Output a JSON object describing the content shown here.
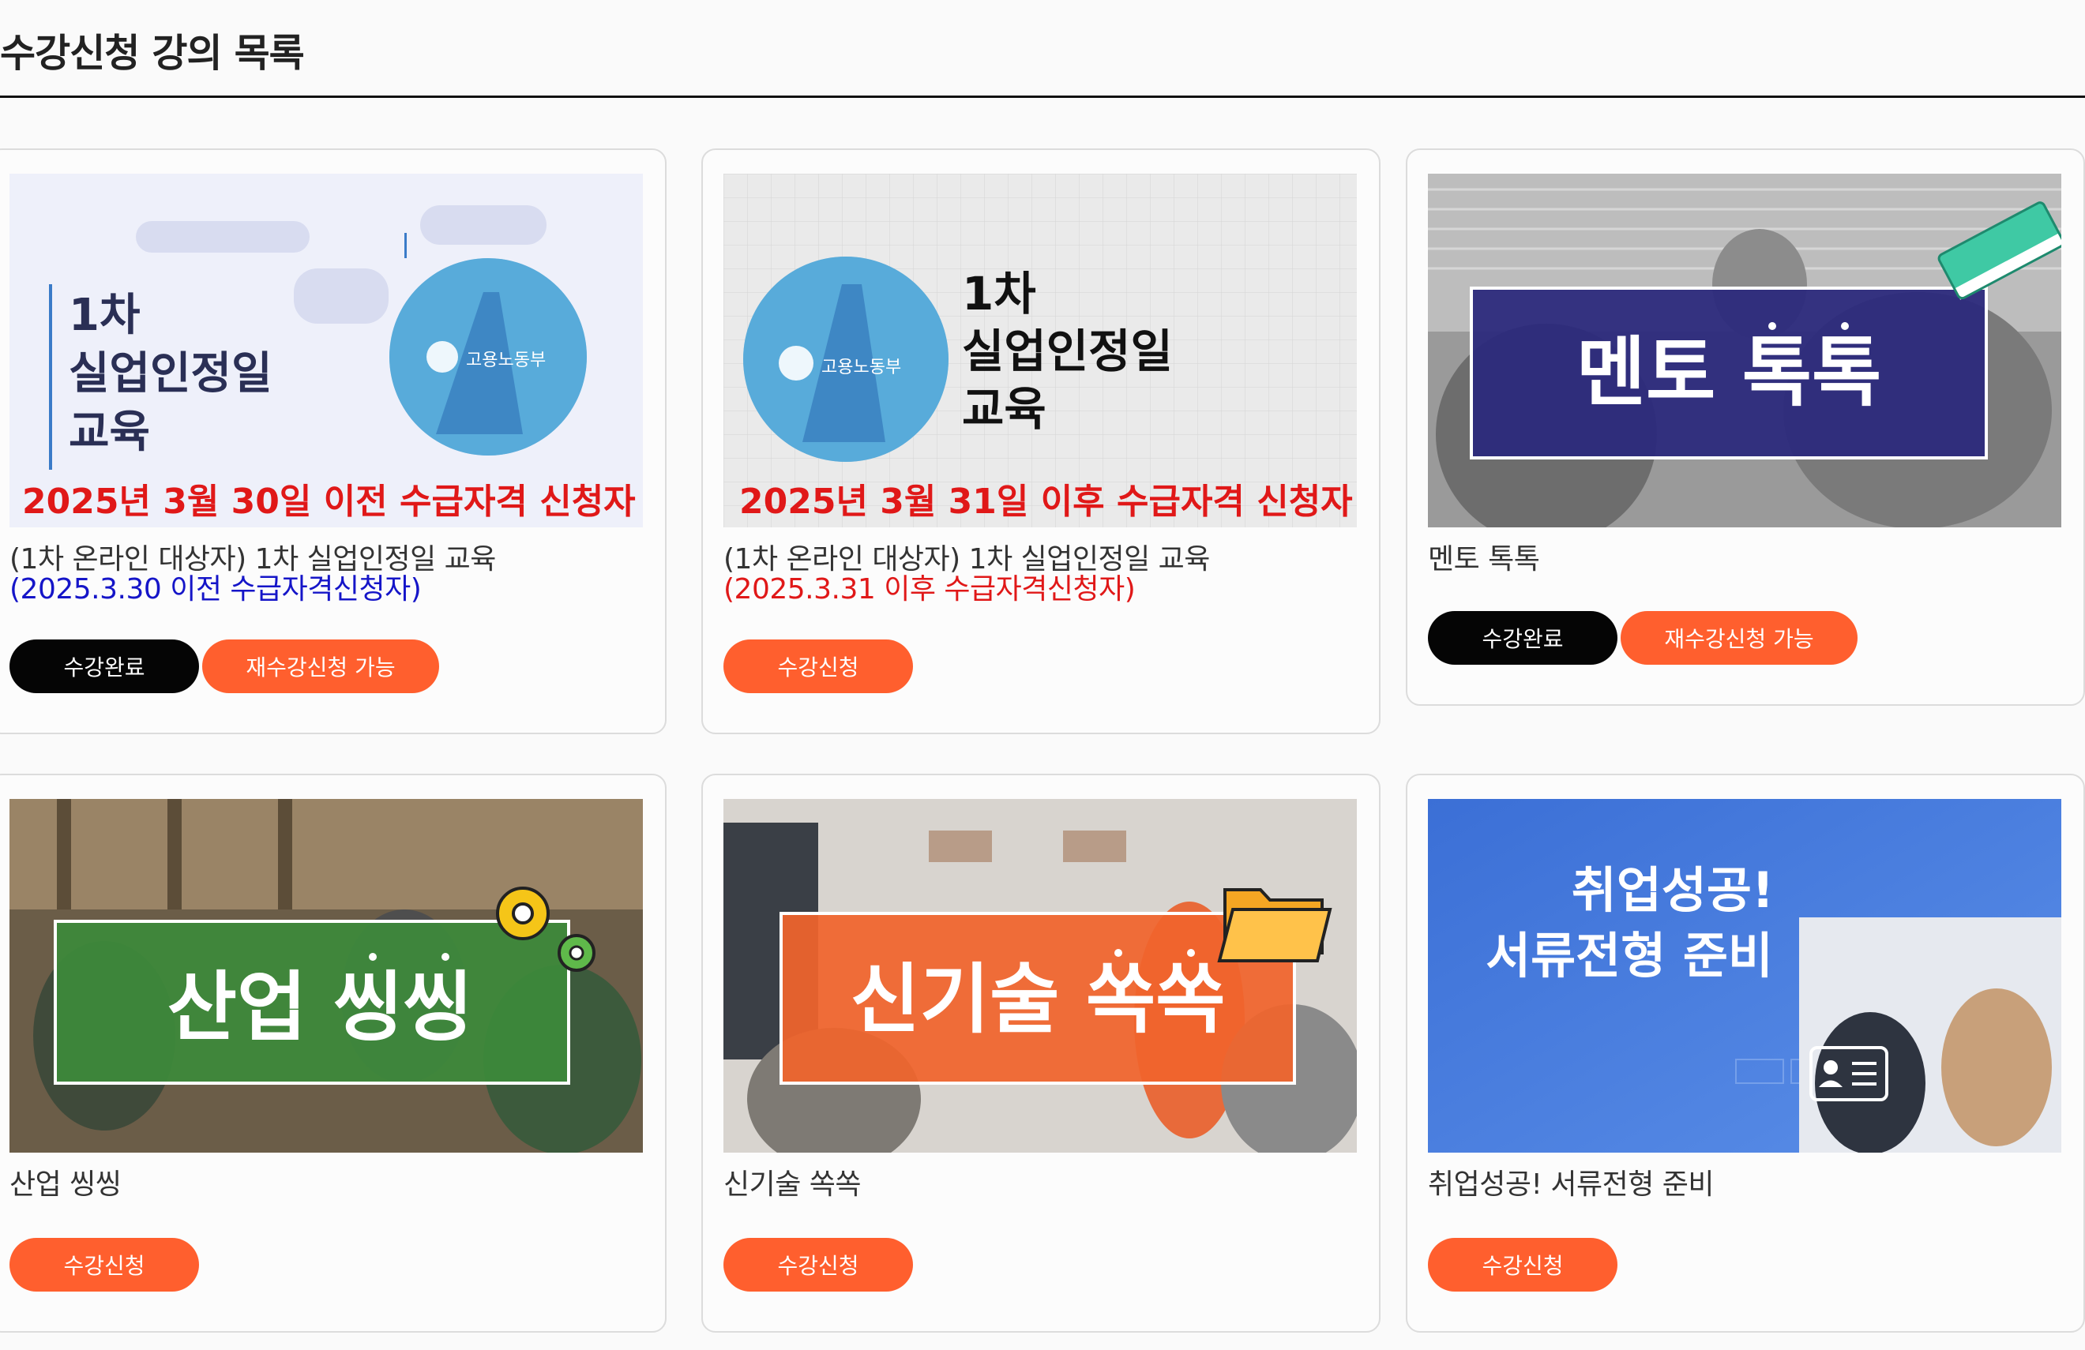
{
  "page": {
    "title": "수강신청 강의 목록"
  },
  "courses": [
    {
      "thumb": {
        "heading": [
          "1차",
          "실업인정일",
          "교육"
        ],
        "logo_text": "고용노동부",
        "banner": "2025년 3월 30일 이전 수급자격 신청자"
      },
      "title_main": "(1차 온라인 대상자) 1차 실업인정일 교육",
      "title_highlight": "(2025.3.30 이전 수급자격신청자)",
      "buttons": {
        "done": "수강완료",
        "retake": "재수강신청 가능"
      }
    },
    {
      "thumb": {
        "heading": [
          "1차",
          "실업인정일",
          "교육"
        ],
        "logo_text": "고용노동부",
        "banner": "2025년 3월 31일 이후 수급자격 신청자"
      },
      "title_main": "(1차 온라인 대상자) 1차 실업인정일 교육",
      "title_highlight": "(2025.3.31 이후 수급자격신청자)",
      "buttons": {
        "apply": "수강신청"
      }
    },
    {
      "thumb": {
        "label": "멘토 톡톡"
      },
      "title_main": "멘토 톡톡",
      "buttons": {
        "done": "수강완료",
        "retake": "재수강신청 가능"
      }
    },
    {
      "thumb": {
        "label": "산업 씽씽"
      },
      "title_main": "산업 씽씽",
      "buttons": {
        "apply": "수강신청"
      }
    },
    {
      "thumb": {
        "label": "신기술 쏙쏙"
      },
      "title_main": "신기술 쏙쏙",
      "buttons": {
        "apply": "수강신청"
      }
    },
    {
      "thumb": {
        "line1": "취업성공!",
        "line2": "서류전형 준비"
      },
      "title_main": "취업성공! 서류전형 준비",
      "buttons": {
        "apply": "수강신청"
      }
    }
  ],
  "colors": {
    "accent_orange": "#ff5f2e",
    "done_black": "#050505",
    "banner_red": "#e01818",
    "highlight_blue": "#1515c8"
  }
}
